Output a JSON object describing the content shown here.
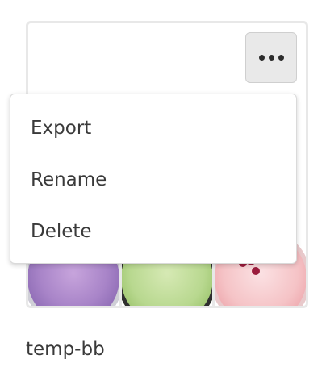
{
  "card": {
    "title": "temp-bb",
    "thumbnails": [
      {
        "name": "purple-smoothie"
      },
      {
        "name": "green-smoothie"
      },
      {
        "name": "pink-smoothie"
      }
    ]
  },
  "more_button": {
    "icon": "more-horizontal-icon"
  },
  "menu": {
    "items": [
      {
        "label": "Export"
      },
      {
        "label": "Rename"
      },
      {
        "label": "Delete"
      }
    ]
  }
}
